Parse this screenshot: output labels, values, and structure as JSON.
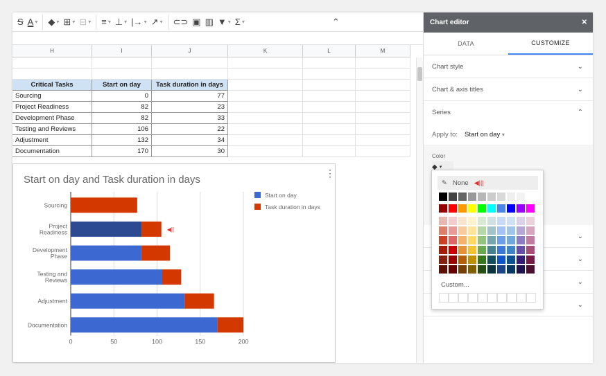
{
  "toolbar": {
    "icons": [
      "strikethrough-icon",
      "text-color-icon",
      "fill-color-icon",
      "borders-icon",
      "merge-cells-icon",
      "horizontal-align-icon",
      "vertical-align-icon",
      "text-wrap-icon",
      "text-rotation-icon",
      "link-icon",
      "comment-icon",
      "chart-icon",
      "filter-icon",
      "functions-icon",
      "collapse-icon"
    ]
  },
  "columns": [
    "H",
    "I",
    "J",
    "K",
    "L",
    "M"
  ],
  "table": {
    "headers": [
      "Critical Tasks",
      "Start on day",
      "Task duration in days"
    ],
    "rows": [
      [
        "Sourcing",
        "0",
        "77"
      ],
      [
        "Project Readiness",
        "82",
        "23"
      ],
      [
        "Development Phase",
        "82",
        "33"
      ],
      [
        "Testing and Reviews",
        "106",
        "22"
      ],
      [
        "Adjustment",
        "132",
        "34"
      ],
      [
        "Documentation",
        "170",
        "30"
      ]
    ]
  },
  "chart_data": {
    "type": "bar",
    "orientation": "horizontal",
    "stacked": true,
    "title": "Start on day and Task duration in days",
    "categories": [
      "Sourcing",
      "Project Readiness",
      "Development Phase",
      "Testing and Reviews",
      "Adjustment",
      "Documentation"
    ],
    "series": [
      {
        "name": "Start on day",
        "values": [
          0,
          82,
          82,
          106,
          132,
          170
        ],
        "color": "#3c68d1"
      },
      {
        "name": "Task duration in days",
        "values": [
          77,
          23,
          33,
          22,
          34,
          30
        ],
        "color": "#d33800"
      }
    ],
    "xlim": [
      0,
      200
    ],
    "xticks": [
      "0",
      "50",
      "100",
      "150",
      "200"
    ],
    "legend": "right",
    "grid": true,
    "highlighted_category": "Project Readiness",
    "highlight_color": "#2c4a92"
  },
  "editor": {
    "title": "Chart editor",
    "close": "✕",
    "tabs": [
      "DATA",
      "CUSTOMIZE"
    ],
    "sections": [
      "Chart style",
      "Chart & axis titles",
      "Series"
    ],
    "apply_label": "Apply to:",
    "apply_value": "Start on day",
    "color_label": "Color"
  },
  "palette": {
    "none_label": "None",
    "custom_label": "Custom...",
    "rows": [
      [
        "#000000",
        "#434343",
        "#666666",
        "#999999",
        "#b7b7b7",
        "#cccccc",
        "#d9d9d9",
        "#efefef",
        "#f3f3f3",
        "#ffffff"
      ],
      [
        "#980000",
        "#ff0000",
        "#ff9900",
        "#ffff00",
        "#00ff00",
        "#00ffff",
        "#4a86e8",
        "#0000ff",
        "#9900ff",
        "#ff00ff"
      ],
      [
        "#e6b8af",
        "#f4cccc",
        "#fce5cd",
        "#fff2cc",
        "#d9ead3",
        "#d0e0e3",
        "#c9daf8",
        "#cfe2f3",
        "#d9d2e9",
        "#ead1dc"
      ],
      [
        "#dd7e6b",
        "#ea9999",
        "#f9cb9c",
        "#ffe599",
        "#b6d7a8",
        "#a2c4c9",
        "#a4c2f4",
        "#9fc5e8",
        "#b4a7d6",
        "#d5a6bd"
      ],
      [
        "#cc4125",
        "#e06666",
        "#f6b26b",
        "#ffd966",
        "#93c47d",
        "#76a5af",
        "#6d9eeb",
        "#6fa8dc",
        "#8e7cc3",
        "#c27ba0"
      ],
      [
        "#a61c00",
        "#cc0000",
        "#e69138",
        "#f1c232",
        "#6aa84f",
        "#45818e",
        "#3c78d8",
        "#3d85c6",
        "#674ea7",
        "#a64d79"
      ],
      [
        "#85200c",
        "#990000",
        "#b45f06",
        "#bf9000",
        "#38761d",
        "#134f5c",
        "#1155cc",
        "#0b5394",
        "#351c75",
        "#741b47"
      ],
      [
        "#5b0f00",
        "#660000",
        "#783f04",
        "#7f6000",
        "#274e13",
        "#0c343d",
        "#1c4587",
        "#073763",
        "#20124d",
        "#4c1130"
      ]
    ]
  }
}
